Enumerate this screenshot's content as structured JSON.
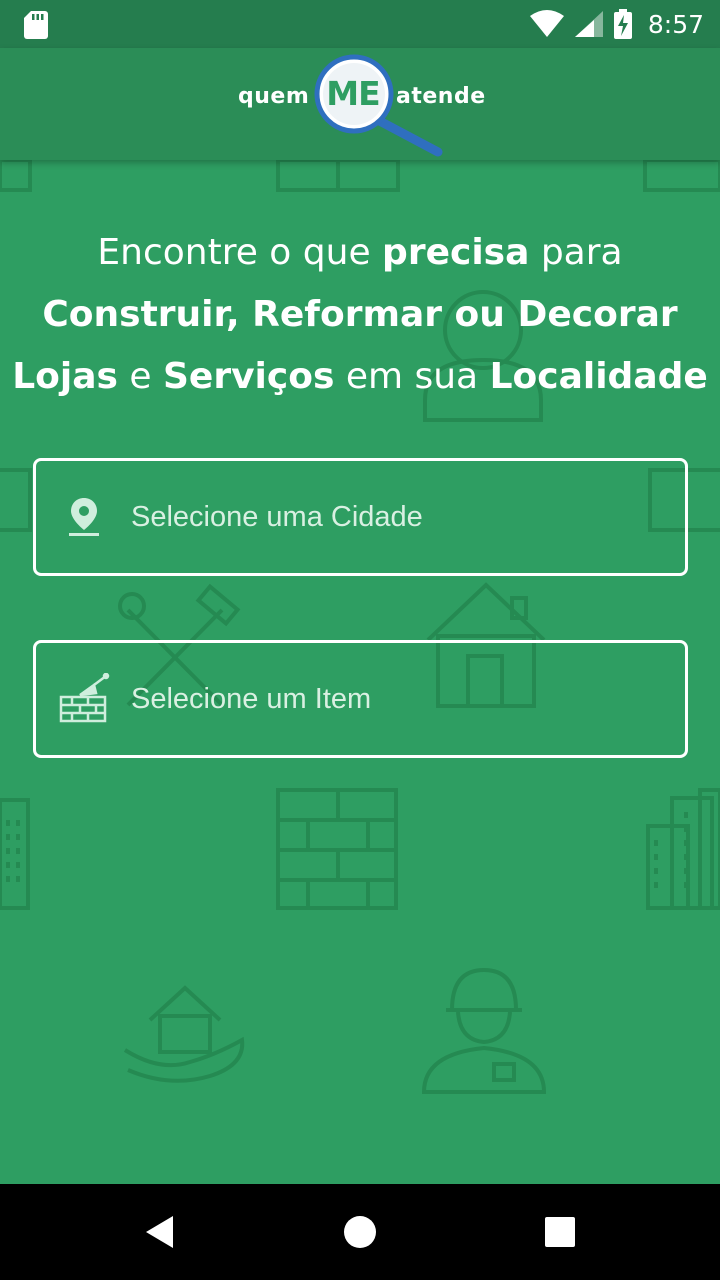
{
  "status_bar": {
    "time": "8:57",
    "icons": [
      "sd-card-icon",
      "wifi-icon",
      "signal-icon",
      "battery-charging-icon"
    ]
  },
  "app_bar": {
    "logo": {
      "word_left": "quem",
      "word_center": "ME",
      "word_right": "atende"
    }
  },
  "headline": {
    "line1": {
      "part1": "Encontre o que ",
      "bold1": "precisa",
      "part2": " para"
    },
    "line2": "Construir, Reformar ou Decorar",
    "line3": {
      "bold1": "Lojas",
      "part1": " e ",
      "bold2": "Serviços",
      "part2": " em sua ",
      "bold3": "Localidade"
    }
  },
  "form": {
    "city": {
      "placeholder": "Selecione uma Cidade",
      "icon": "location-pin-icon"
    },
    "item": {
      "placeholder": "Selecione um Item",
      "icon": "bricks-trowel-icon"
    }
  },
  "nav_bar": {
    "icons": [
      "back-icon",
      "home-icon",
      "recents-icon"
    ]
  },
  "colors": {
    "primary": "#2e9e62",
    "app_bar": "#2b8d57",
    "status_bar": "#257d4e",
    "pattern": "#258a52",
    "logo_blue": "#2f6fbf"
  }
}
